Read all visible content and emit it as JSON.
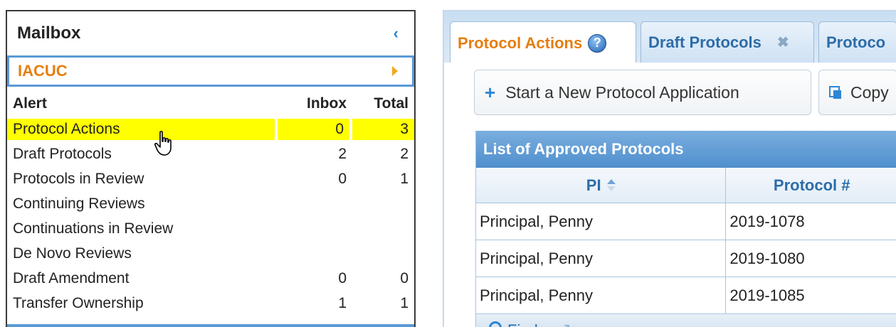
{
  "mailbox": {
    "title": "Mailbox",
    "collapse_icon": "chevron-left-icon",
    "module": "IACUC",
    "columns": {
      "alert": "Alert",
      "inbox": "Inbox",
      "total": "Total"
    },
    "rows": [
      {
        "alert": "Protocol Actions",
        "inbox": "0",
        "total": "3"
      },
      {
        "alert": "Draft Protocols",
        "inbox": "2",
        "total": "2"
      },
      {
        "alert": "Protocols in Review",
        "inbox": "0",
        "total": "1"
      },
      {
        "alert": "Continuing Reviews",
        "inbox": "",
        "total": ""
      },
      {
        "alert": "Continuations in Review",
        "inbox": "",
        "total": ""
      },
      {
        "alert": "De Novo Reviews",
        "inbox": "",
        "total": ""
      },
      {
        "alert": "Draft Amendment",
        "inbox": "0",
        "total": "0"
      },
      {
        "alert": "Transfer Ownership",
        "inbox": "1",
        "total": "1"
      }
    ]
  },
  "tabs": [
    {
      "label": "Protocol Actions",
      "active": true
    },
    {
      "label": "Draft Protocols"
    },
    {
      "label": "Protoco"
    }
  ],
  "toolbar": {
    "new_protocol": "Start a New Protocol Application",
    "copy": "Copy"
  },
  "grid": {
    "caption": "List of Approved Protocols",
    "columns": {
      "pi": "PI",
      "protocol": "Protocol #"
    },
    "rows": [
      {
        "pi": "Principal, Penny",
        "protocol": "2019-1078"
      },
      {
        "pi": "Principal, Penny",
        "protocol": "2019-1080"
      },
      {
        "pi": "Principal, Penny",
        "protocol": "2019-1085"
      }
    ],
    "find": "Find"
  },
  "colors": {
    "accent": "#e67e0f",
    "link": "#2d6da8",
    "highlight": "#ffff00"
  }
}
